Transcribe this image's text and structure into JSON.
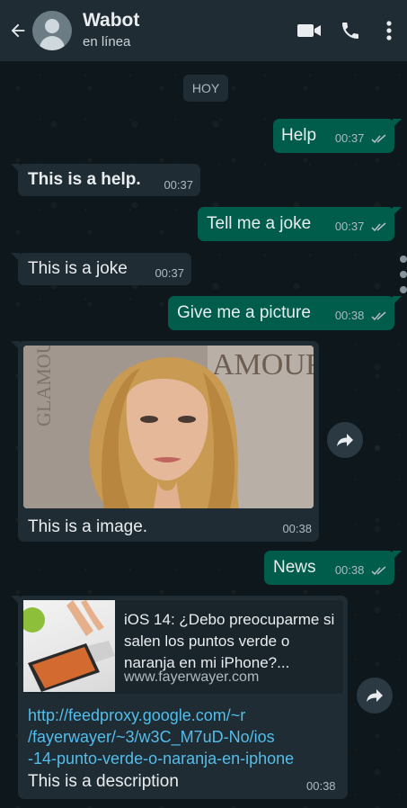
{
  "header": {
    "contact_name": "Wabot",
    "status": "en línea"
  },
  "date_chip": "HOY",
  "messages": [
    {
      "dir": "out",
      "text": "Help",
      "time": "00:37"
    },
    {
      "dir": "in",
      "text": "This is a help.",
      "time": "00:37"
    },
    {
      "dir": "out",
      "text": "Tell me a joke",
      "time": "00:37"
    },
    {
      "dir": "in",
      "text": "This is a joke",
      "time": "00:37"
    },
    {
      "dir": "out",
      "text": "Give me a picture",
      "time": "00:38"
    },
    {
      "dir": "in",
      "type": "image",
      "caption": "This is a image.",
      "time": "00:38"
    },
    {
      "dir": "out",
      "text": "News",
      "time": "00:38"
    },
    {
      "dir": "in",
      "type": "link",
      "preview_title": "iOS 14: ¿Debo preocuparme si salen los puntos verde o naranja en mi iPhone?...",
      "preview_domain": "www.fayerwayer.com",
      "url_lines": [
        "http://feedproxy.google.com/~r",
        "/fayerwayer/~3/w3C_M7uD-No/ios",
        "-14-punto-verde-o-naranja-en-iphone"
      ],
      "description": "This is a description",
      "time": "00:38"
    }
  ],
  "icons": {
    "back": "back-arrow-icon",
    "video": "video-call-icon",
    "call": "phone-icon",
    "menu": "more-vert-icon",
    "forward": "forward-icon",
    "ticks": "double-check-icon"
  },
  "colors": {
    "header_bg": "#1f2c33",
    "outgoing_bubble": "#005c4b",
    "incoming_bubble": "#1f2c33",
    "link": "#53bdeb",
    "background": "#0e171b"
  }
}
